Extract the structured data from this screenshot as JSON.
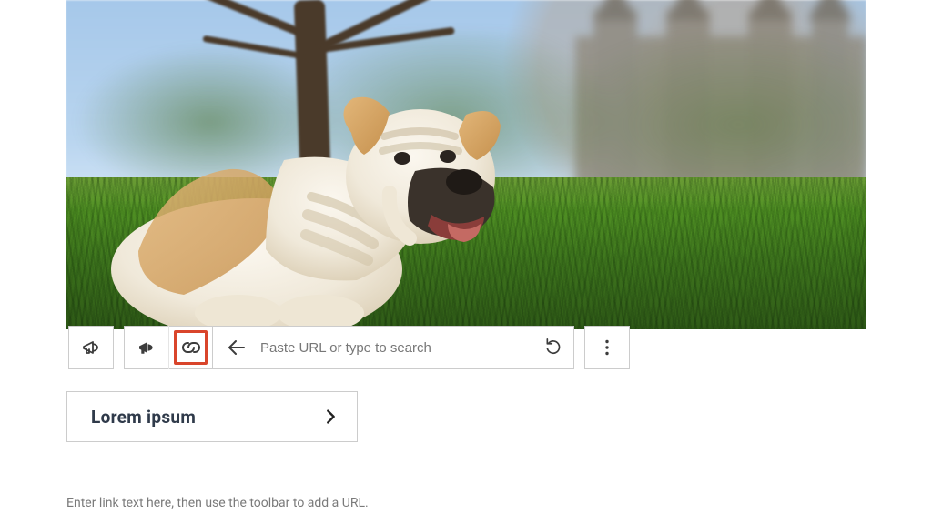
{
  "toolbar": {
    "url_placeholder": "Paste URL or type to search"
  },
  "cta": {
    "label": "Lorem ipsum"
  },
  "hint": "Enter link text here, then use the toolbar to add a URL.",
  "highlight_color": "#d9452b"
}
